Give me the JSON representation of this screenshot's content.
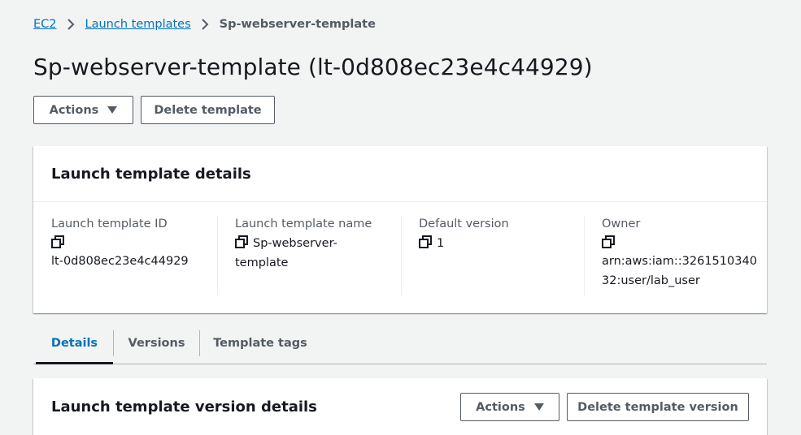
{
  "breadcrumb": {
    "items": [
      "EC2",
      "Launch templates"
    ],
    "current": "Sp-webserver-template"
  },
  "page": {
    "title": "Sp-webserver-template (lt-0d808ec23e4c44929)"
  },
  "header_actions": {
    "actions_label": "Actions",
    "delete_label": "Delete template"
  },
  "details_card": {
    "title": "Launch template details",
    "fields": [
      {
        "label": "Launch template ID",
        "value_lines": [
          "lt-0d808ec23e4c44929"
        ]
      },
      {
        "label": "Launch template name",
        "value_lines": [
          "Sp-webserver-",
          "template"
        ]
      },
      {
        "label": "Default version",
        "value_lines": [
          "1"
        ]
      },
      {
        "label": "Owner",
        "value_lines": [
          "arn:aws:iam::3261510340",
          "32:user/lab_user"
        ]
      }
    ]
  },
  "tabs": [
    {
      "label": "Details",
      "active": true
    },
    {
      "label": "Versions",
      "active": false
    },
    {
      "label": "Template tags",
      "active": false
    }
  ],
  "version_card": {
    "title": "Launch template version details",
    "actions_label": "Actions",
    "delete_version_label": "Delete template version"
  },
  "colors": {
    "link": "#0073bb",
    "background": "#f2f3f3",
    "text": "#16191f",
    "muted": "#545b64"
  },
  "icons": [
    "chevron-right-icon",
    "caret-down-icon",
    "copy-icon"
  ]
}
